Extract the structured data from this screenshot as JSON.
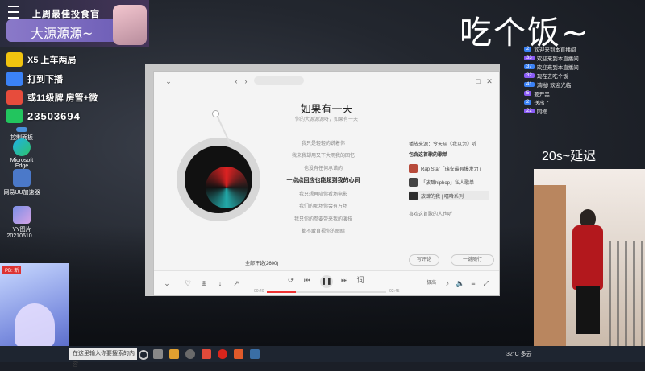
{
  "stream": {
    "banner_top": "上周最佳投食官",
    "streamer_name": "大源源源~",
    "big_title": "吃个饭~",
    "delay_text": "20s~延迟",
    "info_rows": [
      {
        "text": "X5  上车两局"
      },
      {
        "text": "打到下播"
      },
      {
        "text": "或11级牌  房管+微"
      },
      {
        "text": "23503694"
      }
    ],
    "game_tag": "PB: 新"
  },
  "desktop": {
    "icons": [
      {
        "label": "控制面板"
      },
      {
        "label": "Microsoft Edge"
      },
      {
        "label": "网易UU加速器"
      },
      {
        "label": "YY图片 20210610..."
      }
    ]
  },
  "chat": {
    "messages": [
      {
        "badge": "2",
        "text": "欢迎来到本直播间"
      },
      {
        "badge": "33",
        "text": "欢迎来到本直播间"
      },
      {
        "badge": "37",
        "text": "欢迎来到本直播间"
      },
      {
        "badge": "32",
        "text": "现在去吃个饭"
      },
      {
        "badge": "41",
        "text": "满啦! 欢迎光临"
      },
      {
        "badge": "5",
        "text": "要开黑"
      },
      {
        "badge": "2",
        "text": "送出了"
      },
      {
        "badge": "22",
        "text": "同框"
      }
    ]
  },
  "music": {
    "song_title": "如果有一天",
    "song_sub": "你的大源源源呀，如果有一天",
    "lyrics": [
      "我只是轻轻的说着你",
      "我来我却用又下大雨我的回忆",
      "也没有任何承诺的",
      "一点点回应也能超到我的心间",
      "我只想再陪你看场电影",
      "我们的那场你会有万场",
      "我只你的参要带来我的演技",
      "都不敢直视你的眼睛"
    ],
    "active_lyric_index": 3,
    "comments_label": "全部评论(2600)",
    "right_header": "播放来源：今天从《我以为》听",
    "right_section": "包含这首歌的歌单",
    "playlists": [
      {
        "name": "Rap Star「瑞安最具爆发力」",
        "color": "#b74a3a"
      },
      {
        "name": "「放肆hiphop」私人歌单",
        "color": "#444444"
      },
      {
        "name": "放肆的我 | 嘻哈系列",
        "color": "#2c2c2c"
      }
    ],
    "right_footer": "喜欢这首歌的人也听",
    "btn_comment": "写评论",
    "btn_listen": "一键随行",
    "time_current": "00:40",
    "time_total": "02:45",
    "progress": 0.24,
    "quality_badge": "极高"
  },
  "taskbar": {
    "search_placeholder": "在这里输入你要搜索的内容",
    "temp": "32°C 多云"
  }
}
